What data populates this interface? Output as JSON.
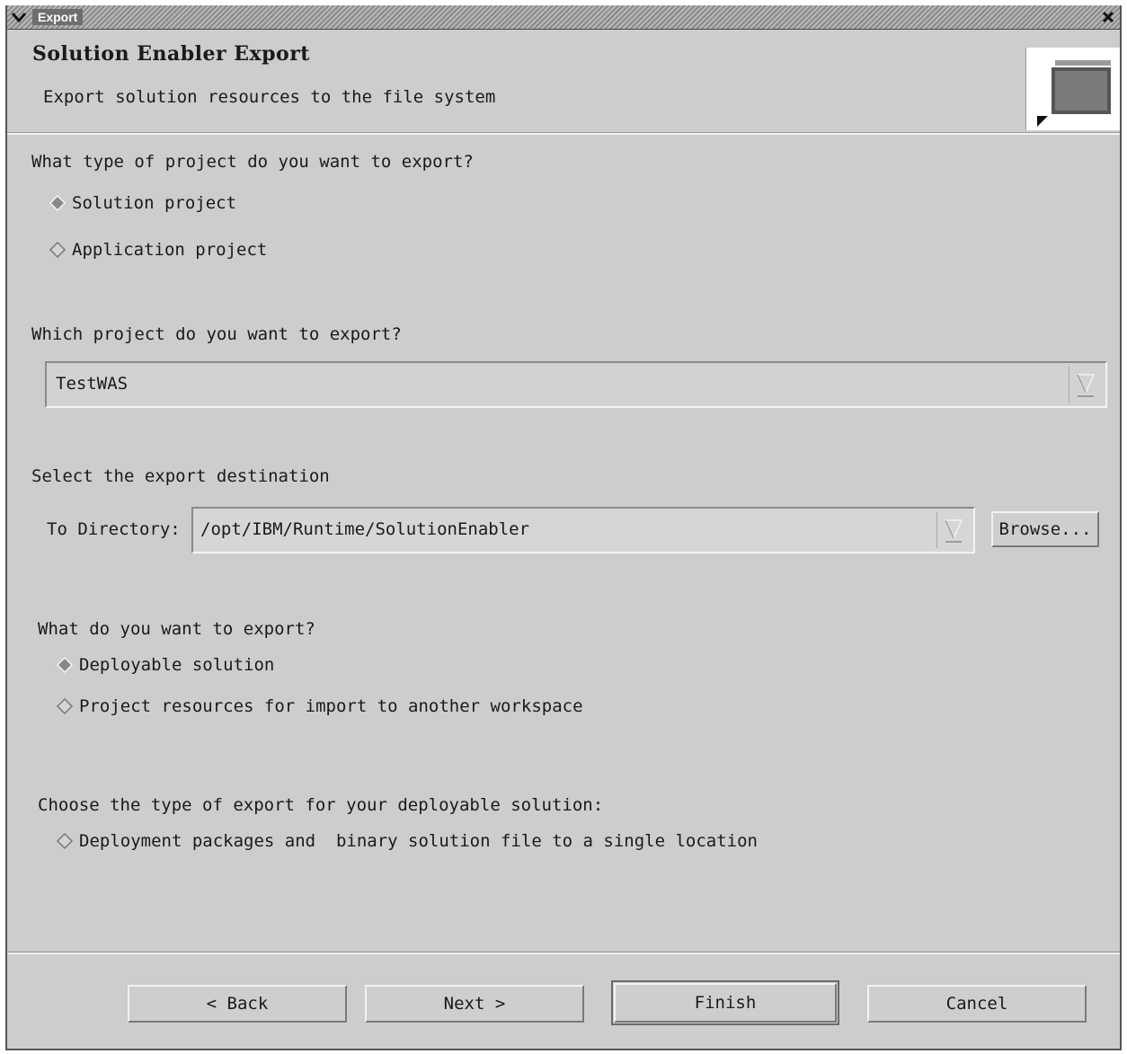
{
  "window": {
    "title": "Export"
  },
  "header": {
    "title": "Solution Enabler Export",
    "description": "Export solution resources to the file system"
  },
  "project_type": {
    "question": "What type of project do you want to export?",
    "options": [
      {
        "label": "Solution project",
        "selected": true
      },
      {
        "label": "Application project",
        "selected": false
      }
    ]
  },
  "project_select": {
    "question": "Which project do you want to export?",
    "value": "TestWAS"
  },
  "destination": {
    "question": "Select the export destination",
    "dir_label": "To Directory:",
    "dir_value": "/opt/IBM/Runtime/SolutionEnabler",
    "browse_label": "Browse..."
  },
  "export_what": {
    "question": "What do you want to export?",
    "options": [
      {
        "label": "Deployable solution",
        "selected": true
      },
      {
        "label": "Project resources for import to another workspace",
        "selected": false
      }
    ]
  },
  "export_type": {
    "question": "Choose the type of export for your deployable solution:",
    "options": [
      {
        "label": "Deployment packages and  binary solution file to a single location",
        "selected": false
      }
    ]
  },
  "buttons": {
    "back": "< Back",
    "next": "Next >",
    "finish": "Finish",
    "cancel": "Cancel"
  }
}
